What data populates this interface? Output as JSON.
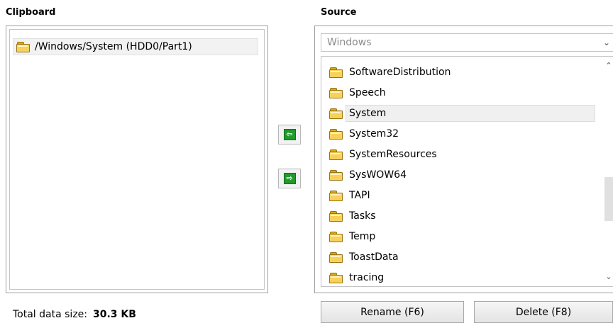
{
  "clipboard": {
    "title": "Clipboard",
    "items": [
      {
        "label": "/Windows/System (HDD0/Part1)",
        "icon": "folder-icon"
      }
    ]
  },
  "source": {
    "title": "Source",
    "dropdown_value": "Windows",
    "items": [
      {
        "label": "SoftwareDistribution"
      },
      {
        "label": "Speech"
      },
      {
        "label": "System",
        "selected": true
      },
      {
        "label": "System32"
      },
      {
        "label": "SystemResources"
      },
      {
        "label": "SysWOW64"
      },
      {
        "label": "TAPI"
      },
      {
        "label": "Tasks"
      },
      {
        "label": "Temp"
      },
      {
        "label": "ToastData"
      },
      {
        "label": "tracing"
      }
    ]
  },
  "transfer": {
    "left_arrow_icon": "arrow-left-icon",
    "right_arrow_icon": "arrow-right-icon"
  },
  "footer": {
    "total_label": "Total data size:",
    "total_value": "30.3 KB",
    "rename_label": "Rename (F6)",
    "delete_label": "Delete (F8)"
  },
  "colors": {
    "arrow_green": "#1f9a2b",
    "folder_yellow": "#f7d15a"
  }
}
